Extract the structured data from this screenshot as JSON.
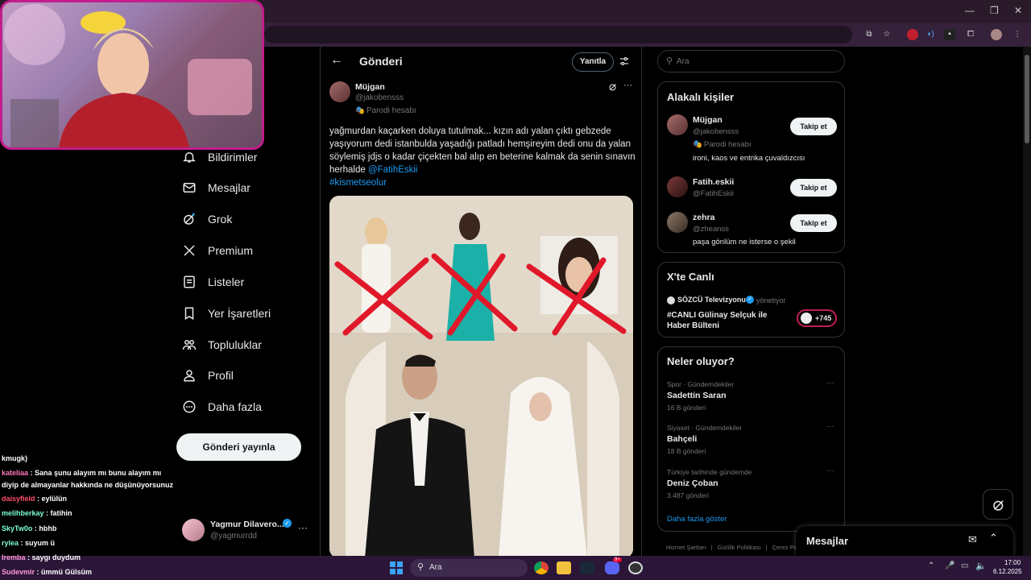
{
  "browser": {
    "window_controls": [
      "—",
      "❐",
      "✕"
    ]
  },
  "stream_chat": [
    {
      "user": "kmugk)",
      "text": "",
      "color": "#ffffff"
    },
    {
      "user": "kateliaa",
      "text": ": Sana şunu alayım mı bunu alayım mı",
      "color": "#ff7bbf"
    },
    {
      "user": "",
      "text": "diyip de almayanlar hakkında ne düşünüyorsunuz",
      "color": "#ffffff"
    },
    {
      "user": "daisyfield",
      "text": ": eylülün",
      "color": "#ff4d6d"
    },
    {
      "user": "melihberkay",
      "text": ": fatihin",
      "color": "#7fffd4"
    },
    {
      "user": "SkyTw0o",
      "text": ": hbhb",
      "color": "#7fffd4"
    },
    {
      "user": "rylea",
      "text": ": suyum ü",
      "color": "#7fffd4"
    },
    {
      "user": "Iremba",
      "text": ": saygı duydum",
      "color": "#ff9ad5"
    },
    {
      "user": "Sudevmir",
      "text": ": ümmü Gülsüm",
      "color": "#ff9ad5"
    }
  ],
  "nav": {
    "items": [
      {
        "label": "Bildirimler",
        "icon": "bell-icon"
      },
      {
        "label": "Mesajlar",
        "icon": "mail-icon"
      },
      {
        "label": "Grok",
        "icon": "grok-icon"
      },
      {
        "label": "Premium",
        "icon": "x-logo-icon"
      },
      {
        "label": "Listeler",
        "icon": "list-icon"
      },
      {
        "label": "Yer İşaretleri",
        "icon": "bookmark-icon"
      },
      {
        "label": "Topluluklar",
        "icon": "communities-icon"
      },
      {
        "label": "Profil",
        "icon": "person-icon"
      },
      {
        "label": "Daha fazla",
        "icon": "more-circle-icon"
      }
    ],
    "post_button": "Gönderi yayınla",
    "account": {
      "name": "Yagmur Dilavero...",
      "handle": "@yagmurrdd"
    }
  },
  "post": {
    "header_title": "Gönderi",
    "reply_button": "Yanıtla",
    "author_name": "Müjgan",
    "author_handle": "@jakobensss",
    "parody_label": "Parodi hesabı",
    "text": "yağmurdan kaçarken doluya tutulmak... kızın adı yalan çıktı gebzede yaşıyorum dedi istanbulda yaşadığı patladı hemşireyim dedi onu da yalan söylemiş jdjs o kadar çiçekten bal alıp en beterine kalmak da senin sınavın herhalde",
    "mention": "@FatihEskii",
    "hashtag": "#kismetseolur"
  },
  "search": {
    "placeholder": "Ara"
  },
  "related_people": {
    "title": "Alakalı kişiler",
    "people": [
      {
        "name": "Müjgan",
        "handle": "@jakobensss",
        "badge": "Parodi hesabı",
        "bio": "ironi, kaos ve entrika çuvaldızcısı",
        "button": "Takip et"
      },
      {
        "name": "Fatih.eskii",
        "handle": "@FatihEskii",
        "badge": "",
        "bio": "",
        "button": "Takip et"
      },
      {
        "name": "zehra",
        "handle": "@zheanss",
        "badge": "",
        "bio": "paşa gönlüm ne isterse o şekil",
        "button": "Takip et"
      }
    ]
  },
  "live": {
    "title": "X'te Canlı",
    "host": "SÖZCÜ Televizyonu",
    "host_role": "yönetiyor",
    "broadcast_title": "#CANLI Gülinay Selçuk ile Haber Bülteni",
    "listeners": "+745"
  },
  "trends": {
    "title": "Neler oluyor?",
    "items": [
      {
        "context": "Spor · Gündemdekiler",
        "name": "Sadettin Saran",
        "count": "16 B gönderi"
      },
      {
        "context": "Siyaset · Gündemdekiler",
        "name": "Bahçeli",
        "count": "18 B gönderi"
      },
      {
        "context": "Türkiye tarihinde gündemde",
        "name": "Deniz Çoban",
        "count": "3.487 gönderi"
      }
    ],
    "show_more": "Daha fazla göster"
  },
  "footer_links": [
    "Hizmet Şartları",
    "|",
    "Gizlilik Politikası",
    "|",
    "Çerez Poli"
  ],
  "messages_drawer": {
    "title": "Mesajlar"
  },
  "taskbar": {
    "search_placeholder": "Ara",
    "time": "17:00",
    "date": "6.12.2025",
    "badge": "9+"
  },
  "colors": {
    "accent": "#1d9bf0",
    "webcam_border": "#c21d8c",
    "cross_red": "#e0182a"
  }
}
